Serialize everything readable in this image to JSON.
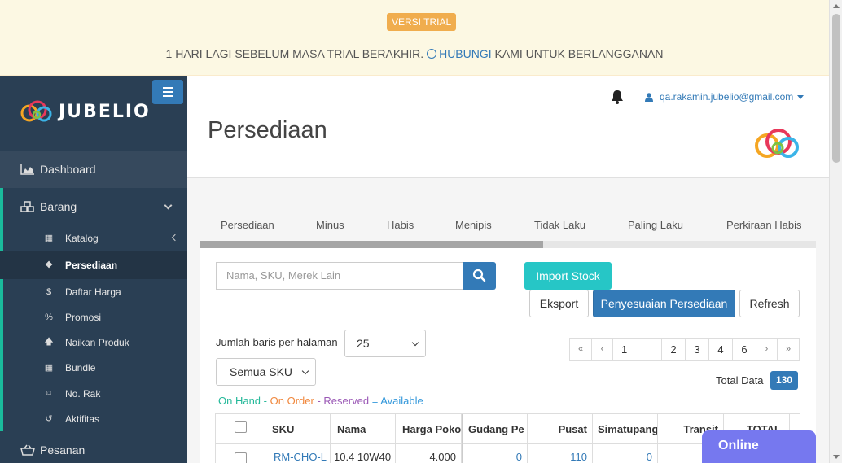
{
  "trial": {
    "badge": "VERSI TRIAL",
    "message_before": "1 HARI LAGI SEBELUM MASA TRIAL BERAKHIR.",
    "link": "HUBUNGI",
    "message_after": "KAMI UNTUK BERLANGGANAN"
  },
  "brand": {
    "name": "JUBELIO"
  },
  "sidebar": {
    "dashboard": "Dashboard",
    "barang": "Barang",
    "sub_items": [
      {
        "label": "Katalog",
        "icon": "grid-icon"
      },
      {
        "label": "Persediaan",
        "icon": "cubes-icon"
      },
      {
        "label": "Daftar Harga",
        "icon": "dollar-icon"
      },
      {
        "label": "Promosi",
        "icon": "percent-icon"
      },
      {
        "label": "Naikan Produk",
        "icon": "arrow-up-icon"
      },
      {
        "label": "Bundle",
        "icon": "th-icon"
      },
      {
        "label": "No. Rak",
        "icon": "bookmark-icon"
      },
      {
        "label": "Aktifitas",
        "icon": "history-icon"
      }
    ],
    "pesanan": "Pesanan"
  },
  "header": {
    "user_email": "qa.rakamin.jubelio@gmail.com",
    "page_title": "Persediaan"
  },
  "tabs": [
    "Persediaan",
    "Minus",
    "Habis",
    "Menipis",
    "Tidak Laku",
    "Paling Laku",
    "Perkiraan Habis"
  ],
  "toolbar": {
    "search_placeholder": "Nama, SKU, Merek Lain",
    "import": "Import Stock",
    "eksport": "Eksport",
    "penyesuaian": "Penyesuaian Persediaan",
    "refresh": "Refresh"
  },
  "filters": {
    "rows_label": "Jumlah baris per halaman",
    "rows_value": "25",
    "sku_value": "Semua SKU"
  },
  "pagination": {
    "first": "«",
    "prev": "‹",
    "current": "1",
    "pages": [
      "2",
      "3",
      "4",
      "6"
    ],
    "next": "›",
    "last": "»"
  },
  "total": {
    "label": "Total Data",
    "value": "130"
  },
  "legend": {
    "on_hand": "On Hand",
    "on_order": "On Order",
    "reserved": "Reserved",
    "available": "Available"
  },
  "table": {
    "headers": [
      "SKU",
      "Nama",
      "Harga Poko",
      "Gudang Pe",
      "Pusat",
      "Simatupang",
      "Transit",
      "TOTAL"
    ],
    "row": {
      "sku": "RM-CHO-L",
      "nama": "10.4 10W40",
      "harga": "4.000",
      "gudang": "0",
      "pusat": "110",
      "simatupang": "0"
    }
  },
  "chat": {
    "label": "Online"
  },
  "colors": {
    "sidebar": "#2a3f54",
    "primary": "#337ab7",
    "teal": "#26c6c6",
    "accent_green": "#1abb9c",
    "chat": "#7678ef"
  }
}
